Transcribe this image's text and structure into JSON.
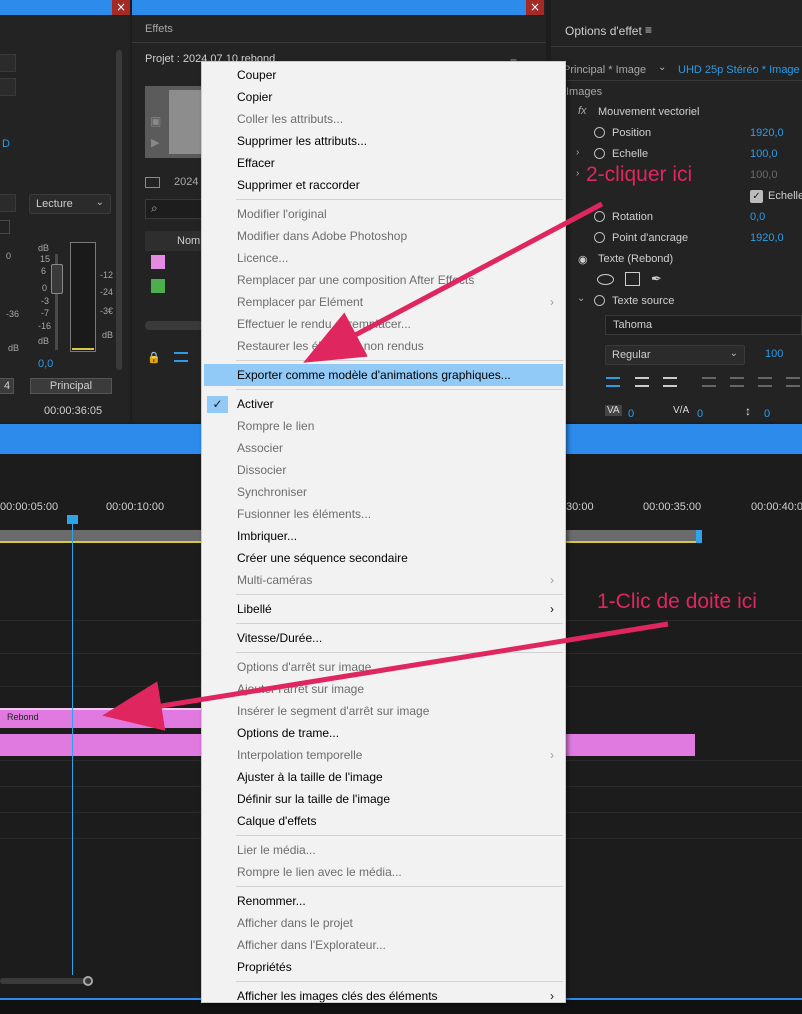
{
  "panels": {
    "effects_title": "Effets",
    "effect_options_title": "Options d'effet"
  },
  "audio_mixer": {
    "lecture_dropdown": "Lecture",
    "db_label": "dB",
    "db_label2": "dB",
    "db_label3": "dB",
    "scale_15": "15",
    "scale_6": "6",
    "scale_0": "0",
    "scale_m3": "-3",
    "scale_m7": "-7",
    "scale_m16": "-16",
    "scale_m36": "-36",
    "value_00": "0,0",
    "principal_button": "Principal",
    "edge_value": "4",
    "timecode": "00:00:36:05",
    "blue_letter": "D",
    "ruler_0": "0",
    "ruler_m12": "-12",
    "ruler_m24": "-24",
    "ruler_m36": "-3€",
    "ruler_db": "dB"
  },
  "project": {
    "title": "Projet : 2024.07.10 rebond",
    "bin_label": "2024",
    "column_name": "Nom",
    "swatch_colors": [
      "#e38be3",
      "#4cae4c"
    ]
  },
  "effect_options": {
    "sequence_left": "Principal * Image",
    "sequence_right": "UHD 25p Stéréo * Image",
    "section_images": "Images",
    "fx_label": "fx",
    "mouvement_vectoriel": "Mouvement vectoriel",
    "position_label": "Position",
    "position_value": "1920,0",
    "echelle_label": "Echelle",
    "echelle_value": "100,0",
    "hidden_value": "100,0",
    "echelle_checkbox_label": "Echelle",
    "rotation_label": "Rotation",
    "rotation_value": "0,0",
    "anchor_label": "Point d'ancrage",
    "anchor_value": "1920,0",
    "texte_label": "Texte (Rebond)",
    "texte_source_label": "Texte source",
    "font_family": "Tahoma",
    "font_style": "Regular",
    "font_size": "100",
    "tracking_value": "0",
    "kerning_value": "0",
    "leading_value": "0"
  },
  "timeline": {
    "tc_5": "00:00:05:00",
    "tc_10": "00:00:10:00",
    "tc_30": ":30:00",
    "tc_35": "00:00:35:00",
    "tc_40": "00:00:40:0",
    "clip_label": "Rebond",
    "clip_color": "#e07ae0",
    "playhead_color": "#2ea3e8"
  },
  "menu": {
    "items": [
      {
        "label": "Couper",
        "enabled": true
      },
      {
        "label": "Copier",
        "enabled": true
      },
      {
        "label": "Coller les attributs...",
        "enabled": false
      },
      {
        "label": "Supprimer les attributs...",
        "enabled": true
      },
      {
        "label": "Effacer",
        "enabled": true
      },
      {
        "label": "Supprimer et raccorder",
        "enabled": true
      },
      {
        "label": "Modifier l'original",
        "enabled": false
      },
      {
        "label": "Modifier dans Adobe Photoshop",
        "enabled": false
      },
      {
        "label": "Licence...",
        "enabled": false
      },
      {
        "label": "Remplacer par une composition After Effects",
        "enabled": false
      },
      {
        "label": "Remplacer par Elément",
        "enabled": false,
        "submenu": true
      },
      {
        "label": "Effectuer le rendu et remplacer...",
        "enabled": false
      },
      {
        "label": "Restaurer les éléments non rendus",
        "enabled": false
      },
      {
        "label": "Exporter comme modèle d'animations graphiques...",
        "enabled": true,
        "highlighted": true
      },
      {
        "label": "Activer",
        "enabled": true,
        "checked": true
      },
      {
        "label": "Rompre le lien",
        "enabled": false
      },
      {
        "label": "Associer",
        "enabled": false
      },
      {
        "label": "Dissocier",
        "enabled": false
      },
      {
        "label": "Synchroniser",
        "enabled": false
      },
      {
        "label": "Fusionner les éléments...",
        "enabled": false
      },
      {
        "label": "Imbriquer...",
        "enabled": true
      },
      {
        "label": "Créer une séquence secondaire",
        "enabled": true
      },
      {
        "label": "Multi-caméras",
        "enabled": false,
        "submenu": true
      },
      {
        "label": "Libellé",
        "enabled": true,
        "submenu": true
      },
      {
        "label": "Vitesse/Durée...",
        "enabled": true
      },
      {
        "label": "Options d'arrêt sur image...",
        "enabled": false
      },
      {
        "label": "Ajouter l'arrêt sur image",
        "enabled": false
      },
      {
        "label": "Insérer le segment d'arrêt sur image",
        "enabled": false
      },
      {
        "label": "Options de trame...",
        "enabled": true
      },
      {
        "label": "Interpolation temporelle",
        "enabled": false,
        "submenu": true
      },
      {
        "label": "Ajuster à la taille de l'image",
        "enabled": true
      },
      {
        "label": "Définir sur la taille de l'image",
        "enabled": true
      },
      {
        "label": "Calque d'effets",
        "enabled": true
      },
      {
        "label": "Lier le média...",
        "enabled": false
      },
      {
        "label": "Rompre le lien avec le média...",
        "enabled": false
      },
      {
        "label": "Renommer...",
        "enabled": true
      },
      {
        "label": "Afficher dans le projet",
        "enabled": false
      },
      {
        "label": "Afficher dans l'Explorateur...",
        "enabled": false
      },
      {
        "label": "Propriétés",
        "enabled": true
      },
      {
        "label": "Afficher les images clés des éléments",
        "enabled": true,
        "submenu": true
      }
    ],
    "submenu_glyph": "›",
    "check_glyph": "✓"
  },
  "annotations": {
    "step1": "1-Clic de doite ici",
    "step2": "2-cliquer ici",
    "color": "#e0265f"
  }
}
